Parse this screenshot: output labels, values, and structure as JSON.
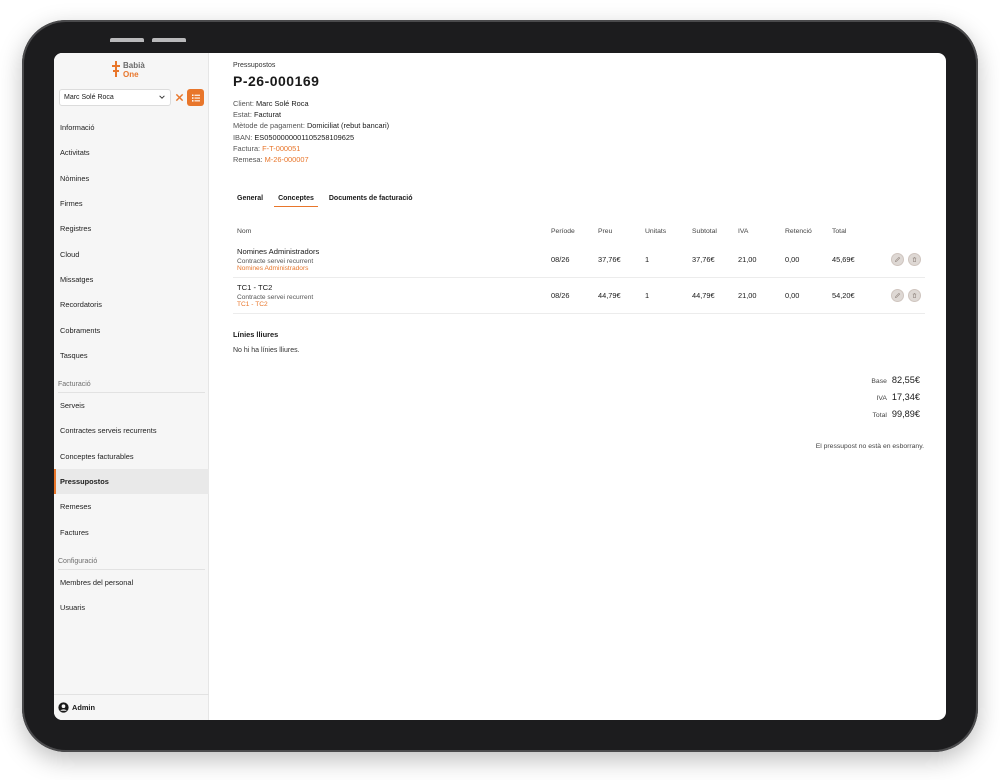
{
  "brand": {
    "line1": "Babià",
    "line2": "One",
    "accent": "#e8762b"
  },
  "client_select": {
    "value": "Marc Solé Roca"
  },
  "nav": {
    "main": [
      "Informació",
      "Activitats",
      "Nòmines",
      "Firmes",
      "Registres",
      "Cloud",
      "Missatges",
      "Recordatoris",
      "Cobraments",
      "Tasques"
    ],
    "section_facturacio": "Facturació",
    "facturacio": [
      "Serveis",
      "Contractes serveis recurrents",
      "Conceptes facturables",
      "Pressupostos",
      "Remeses",
      "Factures"
    ],
    "section_config": "Configuració",
    "config": [
      "Membres del personal",
      "Usuaris"
    ]
  },
  "user": {
    "name": "Admin"
  },
  "page": {
    "breadcrumb": "Pressupostos",
    "title": "P-26-000169"
  },
  "meta": {
    "client_label": "Client:",
    "client": "Marc Solé Roca",
    "estat_label": "Estat:",
    "estat": "Facturat",
    "metode_label": "Mètode de pagament:",
    "metode": "Domiciliat (rebut bancari)",
    "iban_label": "IBAN:",
    "iban": "ES0500000001105258109625",
    "factura_label": "Factura:",
    "factura": "F-T-000051",
    "remesa_label": "Remesa:",
    "remesa": "M-26-000007"
  },
  "tabs": [
    "General",
    "Conceptes",
    "Documents de facturació"
  ],
  "table": {
    "headers": [
      "Nom",
      "Període",
      "Preu",
      "Unitats",
      "Subtotal",
      "IVA",
      "Retenció",
      "Total"
    ],
    "rows": [
      {
        "name": "Nomines Administradors",
        "sub": "Contracte servei recurrent",
        "link": "Nomines Administradors",
        "periode": "08/26",
        "preu": "37,76€",
        "unitats": "1",
        "subtotal": "37,76€",
        "iva": "21,00",
        "retencio": "0,00",
        "total": "45,69€"
      },
      {
        "name": "TC1 - TC2",
        "sub": "Contracte servei recurrent",
        "link": "TC1 - TC2",
        "periode": "08/26",
        "preu": "44,79€",
        "unitats": "1",
        "subtotal": "44,79€",
        "iva": "21,00",
        "retencio": "0,00",
        "total": "54,20€"
      }
    ]
  },
  "free_lines": {
    "title": "Línies lliures",
    "empty": "No hi ha línies lliures."
  },
  "totals": {
    "base_label": "Base",
    "base": "82,55€",
    "iva_label": "IVA",
    "iva": "17,34€",
    "total_label": "Total",
    "total": "99,89€"
  },
  "draft_note": "El pressupost no està en esborrany."
}
